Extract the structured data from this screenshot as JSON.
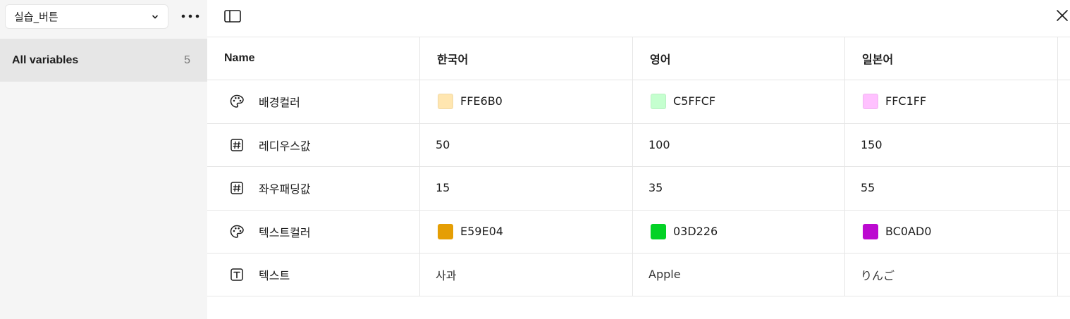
{
  "sidebar": {
    "collection_name": "실습_버튼",
    "group": {
      "label": "All variables",
      "count": "5"
    }
  },
  "table": {
    "headers": [
      "Name",
      "한국어",
      "영어",
      "일본어"
    ],
    "rows": [
      {
        "icon": "palette-icon",
        "name": "배경컬러",
        "values": [
          {
            "text": "FFE6B0",
            "color": "#FFE6B0"
          },
          {
            "text": "C5FFCF",
            "color": "#C5FFCF"
          },
          {
            "text": "FFC1FF",
            "color": "#FFC1FF"
          }
        ]
      },
      {
        "icon": "number-icon",
        "name": "레디우스값",
        "values": [
          {
            "text": "50"
          },
          {
            "text": "100"
          },
          {
            "text": "150"
          }
        ]
      },
      {
        "icon": "number-icon",
        "name": "좌우패딩값",
        "values": [
          {
            "text": "15"
          },
          {
            "text": "35"
          },
          {
            "text": "55"
          }
        ]
      },
      {
        "icon": "palette-icon",
        "name": "텍스트컬러",
        "values": [
          {
            "text": "E59E04",
            "color": "#E59E04"
          },
          {
            "text": "03D226",
            "color": "#03D226"
          },
          {
            "text": "BC0AD0",
            "color": "#BC0AD0"
          }
        ]
      },
      {
        "icon": "text-icon",
        "name": "텍스트",
        "values": [
          {
            "text": "사과"
          },
          {
            "text": "Apple"
          },
          {
            "text": "りんご"
          }
        ]
      }
    ]
  }
}
